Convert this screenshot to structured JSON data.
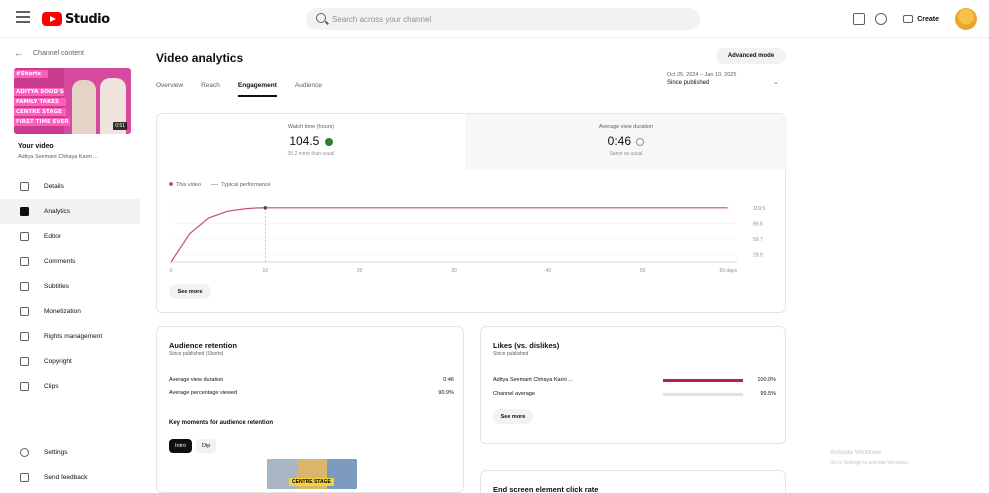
{
  "topbar": {
    "logo_text": "Studio",
    "search_placeholder": "Search across your channel",
    "create_label": "Create"
  },
  "sidebar": {
    "back_label": "Channel content",
    "thumb_banner": "#Shorts",
    "thumb_lines": [
      "ADITYA SOOD'S",
      "FAMILY TAKES",
      "CENTRE STAGE",
      "FIRST TIME EVER"
    ],
    "thumb_duration": "0:51",
    "your_video_label": "Your video",
    "video_subtitle": "Aditya Seemant Chhaya Karni ...",
    "items": [
      {
        "label": "Details",
        "icon": "pencil-icon"
      },
      {
        "label": "Analytics",
        "icon": "analytics-icon",
        "active": true
      },
      {
        "label": "Editor",
        "icon": "editor-icon"
      },
      {
        "label": "Comments",
        "icon": "comments-icon"
      },
      {
        "label": "Subtitles",
        "icon": "subtitles-icon"
      },
      {
        "label": "Monetization",
        "icon": "monetization-icon"
      },
      {
        "label": "Rights management",
        "icon": "rights-icon"
      },
      {
        "label": "Copyright",
        "icon": "copyright-icon"
      },
      {
        "label": "Clips",
        "icon": "clips-icon"
      }
    ],
    "bottom_items": [
      {
        "label": "Settings",
        "icon": "gear-icon"
      },
      {
        "label": "Send feedback",
        "icon": "feedback-icon"
      }
    ]
  },
  "main": {
    "title": "Video analytics",
    "advanced_mode_label": "Advanced mode",
    "tabs": [
      {
        "label": "Overview"
      },
      {
        "label": "Reach"
      },
      {
        "label": "Engagement",
        "active": true
      },
      {
        "label": "Audience"
      }
    ],
    "date_range": {
      "dates": "Oct 25, 2024 – Jan 10, 2025",
      "selected": "Since published"
    },
    "metrics": [
      {
        "label": "Watch time (hours)",
        "value": "104.5",
        "sub": "35.2 more than usual"
      },
      {
        "label": "Average view duration",
        "value": "0:46",
        "sub": "Same as usual"
      }
    ],
    "legend": {
      "series1": "This video",
      "series2": "Typical performance"
    },
    "see_more_label": "See more",
    "retention": {
      "title": "Audience retention",
      "subtitle": "Since published (Shorts)",
      "rows": [
        {
          "label": "Average view duration",
          "value": "0:46"
        },
        {
          "label": "Average percentage viewed",
          "value": "90.9%"
        }
      ],
      "key_moments_title": "Key moments for audience retention",
      "chips": [
        "Intro",
        "Dip"
      ],
      "thumb_caption": "CENTRE STAGE"
    },
    "likes": {
      "title": "Likes (vs. dislikes)",
      "subtitle": "Since published",
      "rows": [
        {
          "label": "Aditya Seemant Chhaya Karni ...",
          "value": "100.0%",
          "fill": 1.0,
          "color": "#c2185b"
        },
        {
          "label": "Channel average",
          "value": "99.5%",
          "fill": 0.0,
          "color": "#c2185b"
        }
      ],
      "see_more_label": "See more"
    },
    "endscreen": {
      "title": "End screen element click rate"
    }
  },
  "chart_data": {
    "type": "line",
    "x_tick_labels": [
      "0",
      "10",
      "20",
      "30",
      "40",
      "50",
      "60 days"
    ],
    "y_tick_labels": [
      "119.5",
      "89.6",
      "59.7",
      "29.9"
    ],
    "x": [
      0,
      2,
      4,
      6,
      8,
      9,
      10,
      15,
      20,
      30,
      40,
      50,
      59
    ],
    "series": [
      {
        "name": "This video",
        "values": [
          0,
          55,
          85,
          98,
          103,
          104,
          104.5,
          104.5,
          104.5,
          104.5,
          104.5,
          104.5,
          104.5
        ],
        "color": "#c2536d"
      }
    ],
    "xlim": [
      0,
      60
    ],
    "ylim": [
      0,
      119.5
    ],
    "marker_x": 10
  },
  "watermark": {
    "line1": "Activate Windows",
    "line2": "Go to Settings to activate Windows."
  }
}
